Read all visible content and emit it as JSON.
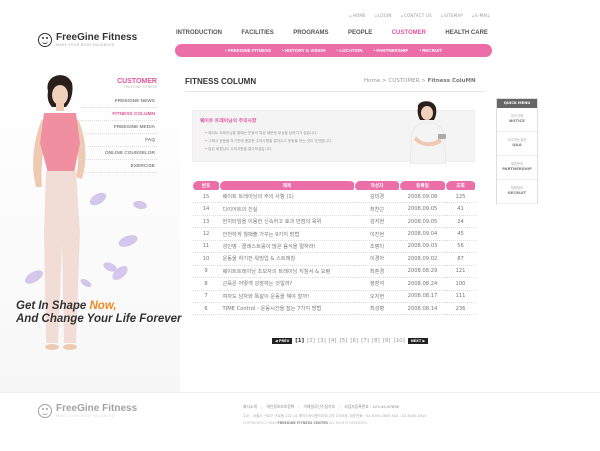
{
  "brand": {
    "name": "FreeGine Fitness",
    "tagline": "MAKE YOUR BODY BALANCED"
  },
  "util_nav": [
    "HOME",
    "LOGIN",
    "CONTACT US",
    "SITEMAP",
    "E-MAIL"
  ],
  "main_nav": [
    {
      "label": "INTRODUCTION",
      "active": false
    },
    {
      "label": "FACILITIES",
      "active": false
    },
    {
      "label": "PROGRAMS",
      "active": false
    },
    {
      "label": "PEOPLE",
      "active": false
    },
    {
      "label": "CUSTOMER",
      "active": true
    },
    {
      "label": "HEALTH CARE",
      "active": false
    }
  ],
  "sub_nav": [
    "FREEGINE FITNESS",
    "HISTORY & VISION",
    "LOCATION",
    "PARTNERSHIP",
    "RECRUIT"
  ],
  "left_menu": {
    "title": "CUSTOMER",
    "subtitle": "FREEGINE FITNESS",
    "items": [
      {
        "label": "FREEGINE NEWS",
        "active": false
      },
      {
        "label": "FITNESS COLUMN",
        "active": true
      },
      {
        "label": "FREEGINE MEDIA",
        "active": false
      },
      {
        "label": "FAQ",
        "active": false
      },
      {
        "label": "ONLINE COUNSELOR",
        "active": false
      },
      {
        "label": "EXERCISE",
        "active": false
      }
    ]
  },
  "slogan": {
    "line1": "Get In Shape",
    "now": "Now,",
    "line2": "And Change Your Life Forever"
  },
  "page": {
    "title": "FITNESS COLUMN",
    "breadcrumb": {
      "home": "Home",
      "sep": ">",
      "section": "CUSTOMER",
      "current": "Fitness ColuMN"
    }
  },
  "notice": {
    "title": "웨이트 트레이닝의 주의사항",
    "lines": [
      "웨이트 트레이닝을 할때는 운동의 특성 때문에 부상을 당하기가 쉽습니다.",
      "그래서 운동을 하기전에 충분한 주의사항을 알아두고 운동을 하는 것이 안전합니다.",
      "많은 회원님이 주의사항을 알아보셨습니다."
    ]
  },
  "table": {
    "headers": [
      "번호",
      "제목",
      "작성자",
      "등록일",
      "조회"
    ],
    "rows": [
      {
        "no": "15",
        "title": "웨이트 트레이닝의 주의 사항 (1)",
        "author": "김미경",
        "date": "2008.09.08",
        "views": "125"
      },
      {
        "no": "14",
        "title": "다이어트의 진실",
        "author": "최찬근",
        "date": "2008.09.05",
        "views": "41"
      },
      {
        "no": "13",
        "title": "헌치타임을 이용한 신속하고 효과 만점의 육위",
        "author": "김지현",
        "date": "2008.09.05",
        "views": "24"
      },
      {
        "no": "12",
        "title": "안전하게 월매출 가꾸는 9가지 방법",
        "author": "이진현",
        "date": "2008.09.04",
        "views": "45"
      },
      {
        "no": "11",
        "title": "성인병 · 콜레스트롤이 많은 음식을 멀하라!",
        "author": "조병이",
        "date": "2008.09.03",
        "views": "56"
      },
      {
        "no": "10",
        "title": "운동을 하기전 워밍업 & 스트레칭",
        "author": "이경아",
        "date": "2008.09.02",
        "views": "87"
      },
      {
        "no": "9",
        "title": "웨이트트레이닝 초보자의 트레이닝 지침서 & 요령",
        "author": "최혼경",
        "date": "2008.08.29",
        "views": "121"
      },
      {
        "no": "8",
        "title": "근육은 어떻게 성장하는 것일까?",
        "author": "정장석",
        "date": "2008.08.24",
        "views": "100"
      },
      {
        "no": "7",
        "title": "여자도 남자와 똑같이 운동을 해야 할까!",
        "author": "오지현",
        "date": "2008.08.17",
        "views": "111"
      },
      {
        "no": "6",
        "title": "TIME Control - 운동시간을 잡는 7가지 방법",
        "author": "최성병",
        "date": "2008.08.14",
        "views": "236"
      }
    ]
  },
  "pager": {
    "prev": "PREV",
    "next": "NEXT",
    "pages": [
      "[1]",
      "[2]",
      "[3]",
      "[4]",
      "[5]",
      "[6]",
      "[7]",
      "[8]",
      "[9]",
      "[10]"
    ],
    "current": "[1]"
  },
  "quick_menu": {
    "title": "QUICK MENU",
    "items": [
      {
        "ko": "공지사항",
        "en": "NOTICE"
      },
      {
        "ko": "자주하는질문",
        "en": "Q&A"
      },
      {
        "ko": "제휴문의",
        "en": "PARTNERSHIP"
      },
      {
        "ko": "채용정보",
        "en": "RECRUIT"
      }
    ]
  },
  "footer": {
    "links": [
      "회사소개",
      "개인정보보호정책",
      "이메일무단수집거부",
      "사업자등록번호 : 123-45-67890"
    ],
    "address": "주소 : 서울시 구로구 구로동 222-14 에이스하이엔드타워 2차 1303호, 대표전화 : 02-6340-1600  FAX : 02-6340-1610",
    "copyright_prefix": "COPYRIGHT(C) 2008",
    "copyright_company": "FREEGINE FITNESS CENTER",
    "copyright_suffix": "ALL RIGHTS RESERVED"
  },
  "colors": {
    "accent": "#ec6ea8",
    "accent_text": "#e0569a",
    "orange": "#f28a1e"
  }
}
